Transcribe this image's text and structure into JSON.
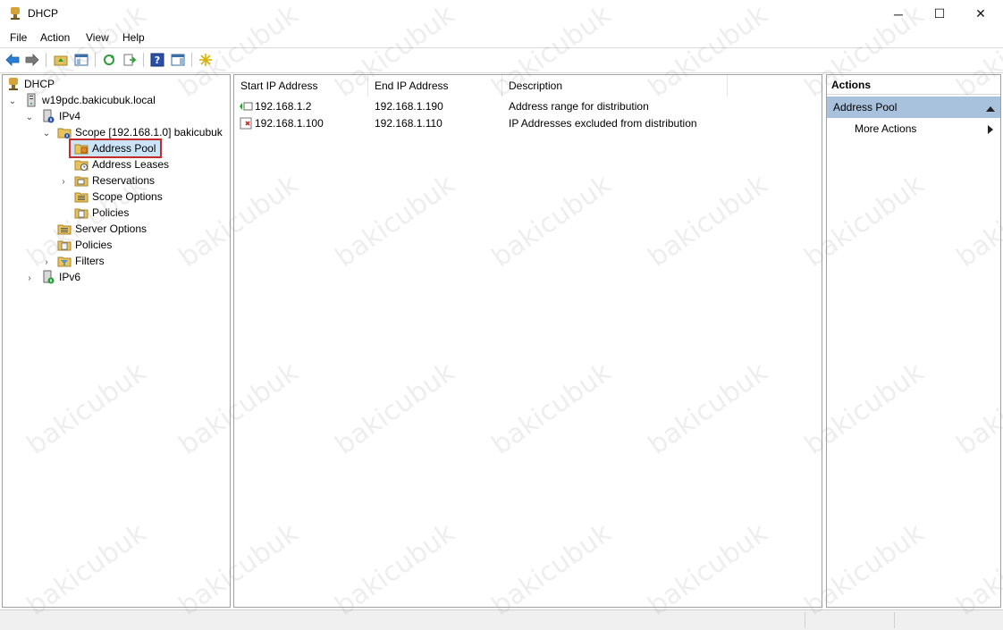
{
  "window": {
    "title": "DHCP",
    "minimize": "─",
    "maximize": "☐",
    "close": "✕"
  },
  "menu": [
    "File",
    "Action",
    "View",
    "Help"
  ],
  "toolbar": {
    "buttons": [
      "back-arrow-icon",
      "forward-arrow-icon",
      "up-folder-icon",
      "show-hide-tree-icon",
      "refresh-icon",
      "export-list-icon",
      "help-icon",
      "action-pane-icon",
      "star-burst-icon"
    ]
  },
  "tree": {
    "root": "DHCP",
    "server": "w19pdc.bakicubuk.local",
    "ipv4": "IPv4",
    "scope": "Scope [192.168.1.0] bakicubuk",
    "address_pool": "Address Pool",
    "address_leases": "Address Leases",
    "reservations": "Reservations",
    "scope_options": "Scope Options",
    "scope_policies": "Policies",
    "server_options": "Server Options",
    "policies": "Policies",
    "filters": "Filters",
    "ipv6": "IPv6"
  },
  "list": {
    "columns": [
      "Start IP Address",
      "End IP Address",
      "Description"
    ],
    "rows": [
      {
        "start": "192.168.1.2",
        "end": "192.168.1.190",
        "description": "Address range for distribution"
      },
      {
        "start": "192.168.1.100",
        "end": "192.168.1.110",
        "description": "IP Addresses excluded from distribution"
      }
    ]
  },
  "actions": {
    "title": "Actions",
    "section": "Address Pool",
    "more": "More Actions"
  },
  "watermark": "bakicubuk",
  "colors": {
    "selection_highlight": "#c42b2b",
    "actions_header": "#a8c1dd"
  }
}
